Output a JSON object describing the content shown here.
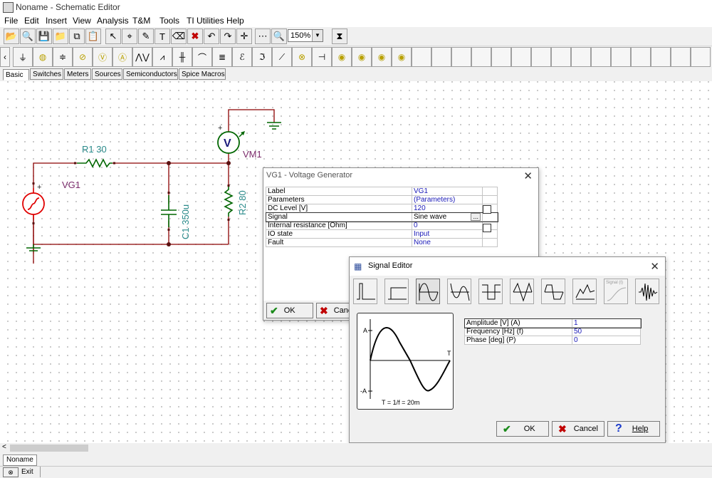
{
  "app": {
    "title": "Noname - Schematic Editor"
  },
  "menu": [
    "File",
    "Edit",
    "Insert",
    "View",
    "Analysis",
    "T&M",
    "Tools",
    "TI Utilities",
    "Help"
  ],
  "toolbar": {
    "zoom_value": "150%"
  },
  "component_tabs": [
    "Basic",
    "Switches",
    "Meters",
    "Sources",
    "Semiconductors",
    "Spice Macros"
  ],
  "schematic": {
    "r1": "R1 30",
    "vg1": "VG1",
    "vm1": "VM1",
    "c1": "C1 350u",
    "r2": "R2 80",
    "vm_letter": "V",
    "plus": "+"
  },
  "vg_dialog": {
    "title": "VG1 - Voltage Generator",
    "rows": [
      {
        "label": "Label",
        "value": "VG1"
      },
      {
        "label": "Parameters",
        "value": "(Parameters)"
      },
      {
        "label": "DC Level [V]",
        "value": "120"
      },
      {
        "label": "Signal",
        "value": "Sine wave"
      },
      {
        "label": "Internal resistance [Ohm]",
        "value": "0"
      },
      {
        "label": "IO state",
        "value": "Input"
      },
      {
        "label": "Fault",
        "value": "None"
      }
    ],
    "ellipsis": "...",
    "ok": "OK",
    "cancel": "Canc"
  },
  "signal_editor": {
    "title": "Signal Editor",
    "params": [
      {
        "label": "Amplitude [V] (A)",
        "value": "1"
      },
      {
        "label": "Frequency [Hz] (f)",
        "value": "50"
      },
      {
        "label": "Phase [deg] (P)",
        "value": "0"
      }
    ],
    "preview": {
      "a_plus": "A",
      "a_minus": "-A",
      "t_label": "T",
      "caption": "T = 1/f = 20m"
    },
    "signal_button_label": "Signal (t)",
    "ok": "OK",
    "cancel": "Cancel",
    "help": "Help"
  },
  "bottom": {
    "doc_tab": "Noname",
    "status_exit": "Exit"
  },
  "colors": {
    "wire": "#8b0000",
    "resistor": "#008000",
    "label_teal": "#2a8a8a",
    "label_purple": "#7a2a6a",
    "value_blue": "#1a1ab8",
    "source_red": "#e00000"
  }
}
